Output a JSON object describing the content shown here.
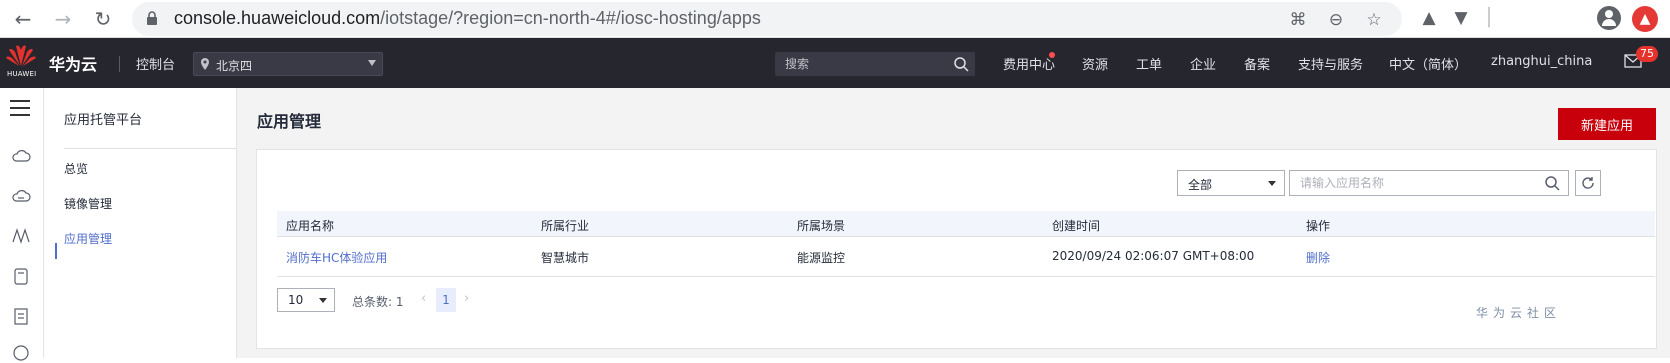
{
  "browser": {
    "url_host": "console.huaweicloud.com",
    "url_path": "/iotstage/?region=cn-north-4#/iosc-hosting/apps"
  },
  "topbar": {
    "logo_text": "HUAWEI",
    "brand": "华为云",
    "console": "控制台",
    "region": "北京四",
    "search_placeholder": "搜索",
    "nav": [
      "费用中心",
      "资源",
      "工单",
      "企业",
      "备案",
      "支持与服务",
      "中文（简体）",
      "zhanghui_china"
    ],
    "mail_badge": "75"
  },
  "subnav": {
    "title": "应用托管平台",
    "items": [
      "总览",
      "镜像管理",
      "应用管理"
    ],
    "active": "应用管理"
  },
  "main": {
    "title": "应用管理",
    "create_button": "新建应用",
    "filter_value": "全部",
    "search_placeholder": "请输入应用名称"
  },
  "table": {
    "headers": [
      "应用名称",
      "所属行业",
      "所属场景",
      "创建时间",
      "操作"
    ],
    "rows": [
      [
        "消防车HC体验应用",
        "智慧城市",
        "能源监控",
        "2020/09/24 02:06:07 GMT+08:00",
        "删除"
      ]
    ]
  },
  "pagination": {
    "page_size": "10",
    "total": "总条数: 1",
    "current_page": "1"
  },
  "watermark": "华为云社区",
  "colors": {
    "topbar_bg": "#26262e",
    "primary_red": "#c7000b",
    "link_blue": "#526ecc"
  }
}
